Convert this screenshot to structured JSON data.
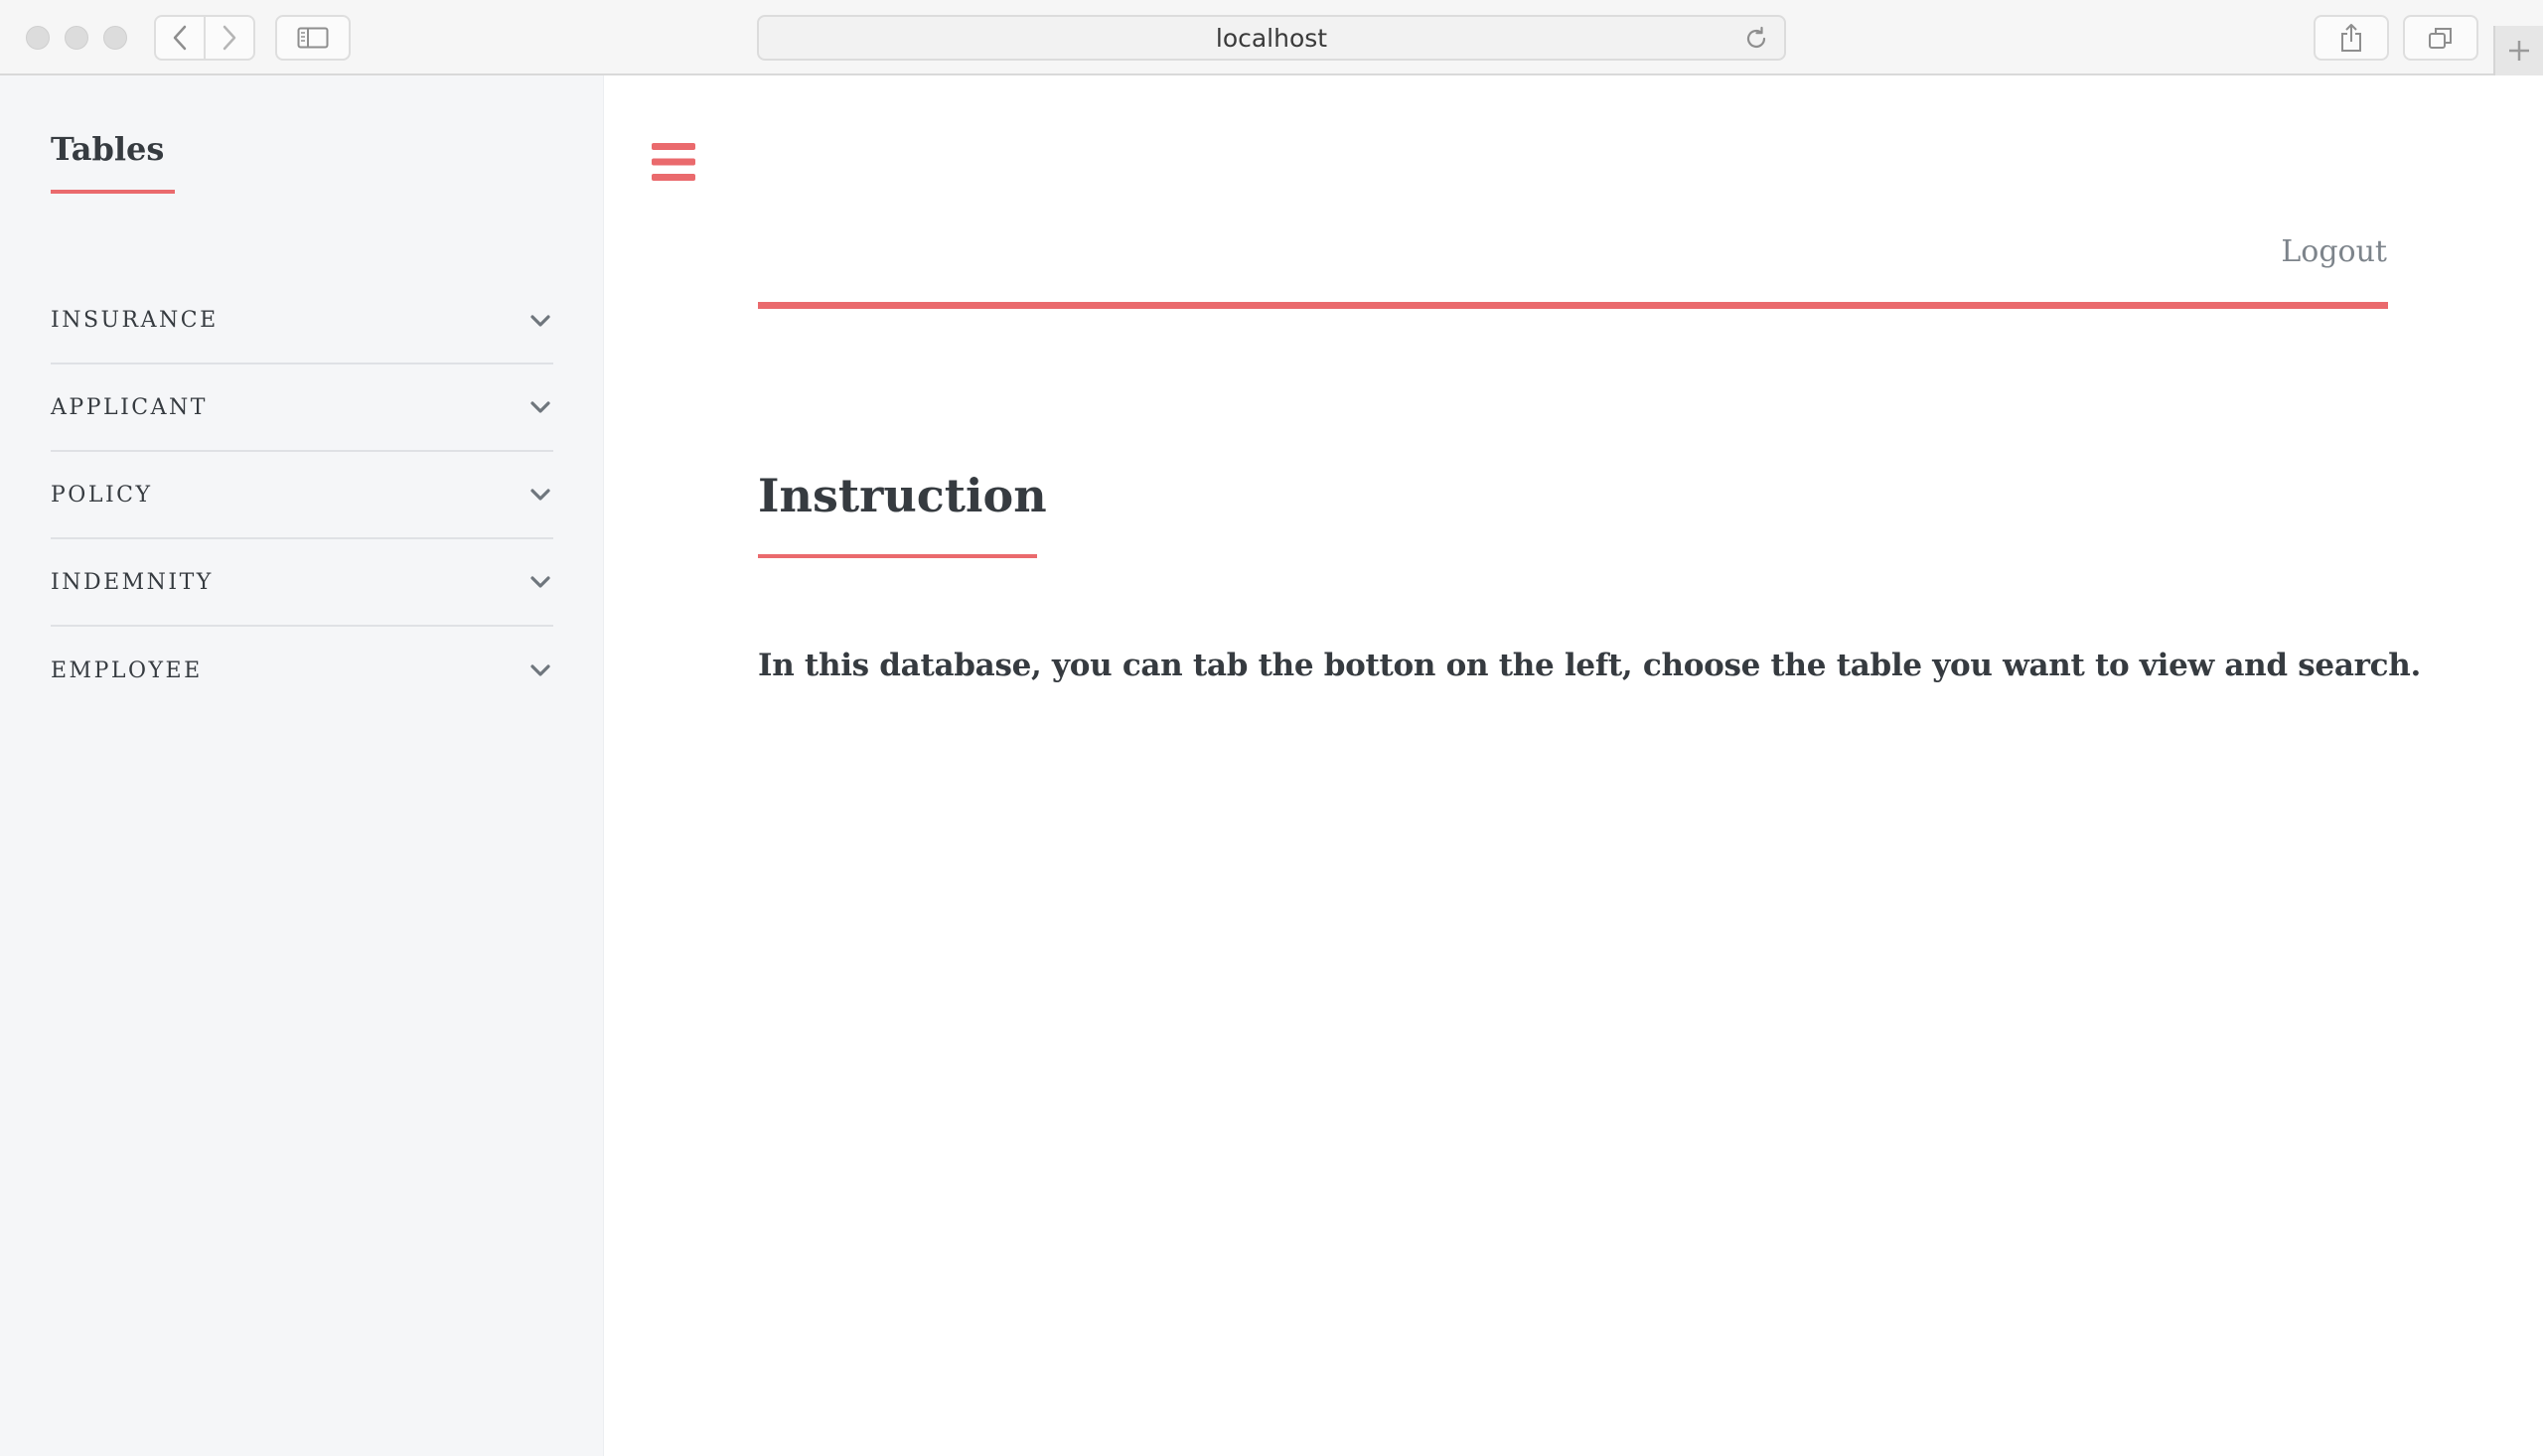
{
  "browser": {
    "url": "localhost"
  },
  "sidebar": {
    "title": "Tables",
    "items": [
      {
        "label": "INSURANCE"
      },
      {
        "label": "APPLICANT"
      },
      {
        "label": "POLICY"
      },
      {
        "label": "INDEMNITY"
      },
      {
        "label": "EMPLOYEE"
      }
    ]
  },
  "header": {
    "logout_label": "Logout"
  },
  "main": {
    "title": "Instruction",
    "body": "In this database, you can tab the botton on the left, choose the table you want to view and search."
  },
  "colors": {
    "accent": "#ea6a6d",
    "text": "#363b40",
    "muted": "#7d848b",
    "sidebar_bg": "#f5f6f8"
  }
}
